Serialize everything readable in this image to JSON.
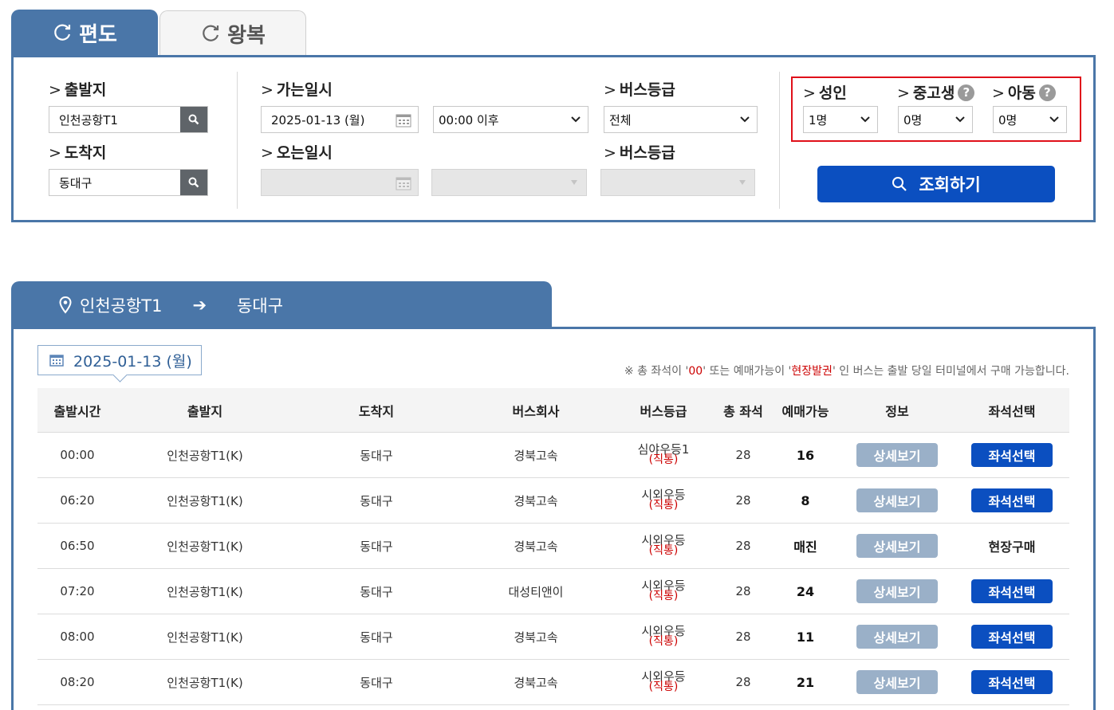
{
  "tabs": {
    "oneway_label": "편도",
    "roundtrip_label": "왕복"
  },
  "search": {
    "departure_label": "출발지",
    "departure_value": "인천공항T1",
    "arrival_label": "도착지",
    "arrival_value": "동대구",
    "go_datetime_label": "가는일시",
    "go_date_value": "2025-01-13 (월)",
    "go_time_value": "00:00 이후",
    "return_datetime_label": "오는일시",
    "bus_grade_label": "버스등급",
    "bus_grade_value": "전체",
    "return_bus_grade_label": "버스등급",
    "adult_label": "성인",
    "adult_value": "1명",
    "teen_label": "중고생",
    "teen_value": "0명",
    "child_label": "아동",
    "child_value": "0명",
    "help_glyph": "?",
    "query_button": "조회하기"
  },
  "route": {
    "from": "인천공항T1",
    "arrow": "➔",
    "to": "동대구"
  },
  "results": {
    "date": "2025-01-13 (월)",
    "notice_prefix": "※ 총 좌석이 '",
    "notice_zero": "00",
    "notice_mid": "' 또는 예매가능이 '",
    "notice_onsite": "현장발권",
    "notice_suffix": "' 인 버스는 출발 당일 터미널에서 구매 가능합니다.",
    "columns": [
      "출발시간",
      "출발지",
      "도착지",
      "버스회사",
      "버스등급",
      "총 좌석",
      "예매가능",
      "정보",
      "좌석선택"
    ],
    "rows": [
      {
        "time": "00:00",
        "from": "인천공항T1(K)",
        "to": "동대구",
        "company": "경북고속",
        "grade": "심야우등1",
        "grade_sub": "(직통)",
        "seats": "28",
        "available": "16",
        "info": "상세보기",
        "select": "좌석선택",
        "select_type": "button"
      },
      {
        "time": "06:20",
        "from": "인천공항T1(K)",
        "to": "동대구",
        "company": "경북고속",
        "grade": "시외우등",
        "grade_sub": "(직통)",
        "seats": "28",
        "available": "8",
        "info": "상세보기",
        "select": "좌석선택",
        "select_type": "button"
      },
      {
        "time": "06:50",
        "from": "인천공항T1(K)",
        "to": "동대구",
        "company": "경북고속",
        "grade": "시외우등",
        "grade_sub": "(직통)",
        "seats": "28",
        "available": "매진",
        "info": "상세보기",
        "select": "현장구매",
        "select_type": "text"
      },
      {
        "time": "07:20",
        "from": "인천공항T1(K)",
        "to": "동대구",
        "company": "대성티앤이",
        "grade": "시외우등",
        "grade_sub": "(직통)",
        "seats": "28",
        "available": "24",
        "info": "상세보기",
        "select": "좌석선택",
        "select_type": "button"
      },
      {
        "time": "08:00",
        "from": "인천공항T1(K)",
        "to": "동대구",
        "company": "경북고속",
        "grade": "시외우등",
        "grade_sub": "(직통)",
        "seats": "28",
        "available": "11",
        "info": "상세보기",
        "select": "좌석선택",
        "select_type": "button"
      },
      {
        "time": "08:20",
        "from": "인천공항T1(K)",
        "to": "동대구",
        "company": "경북고속",
        "grade": "시외우등",
        "grade_sub": "(직통)",
        "seats": "28",
        "available": "21",
        "info": "상세보기",
        "select": "좌석선택",
        "select_type": "button"
      }
    ]
  },
  "colors": {
    "brand_blue": "#4a76a8",
    "primary_button": "#0b4fc0",
    "detail_button": "#9ab0c8",
    "highlight_red": "#e0101a"
  }
}
